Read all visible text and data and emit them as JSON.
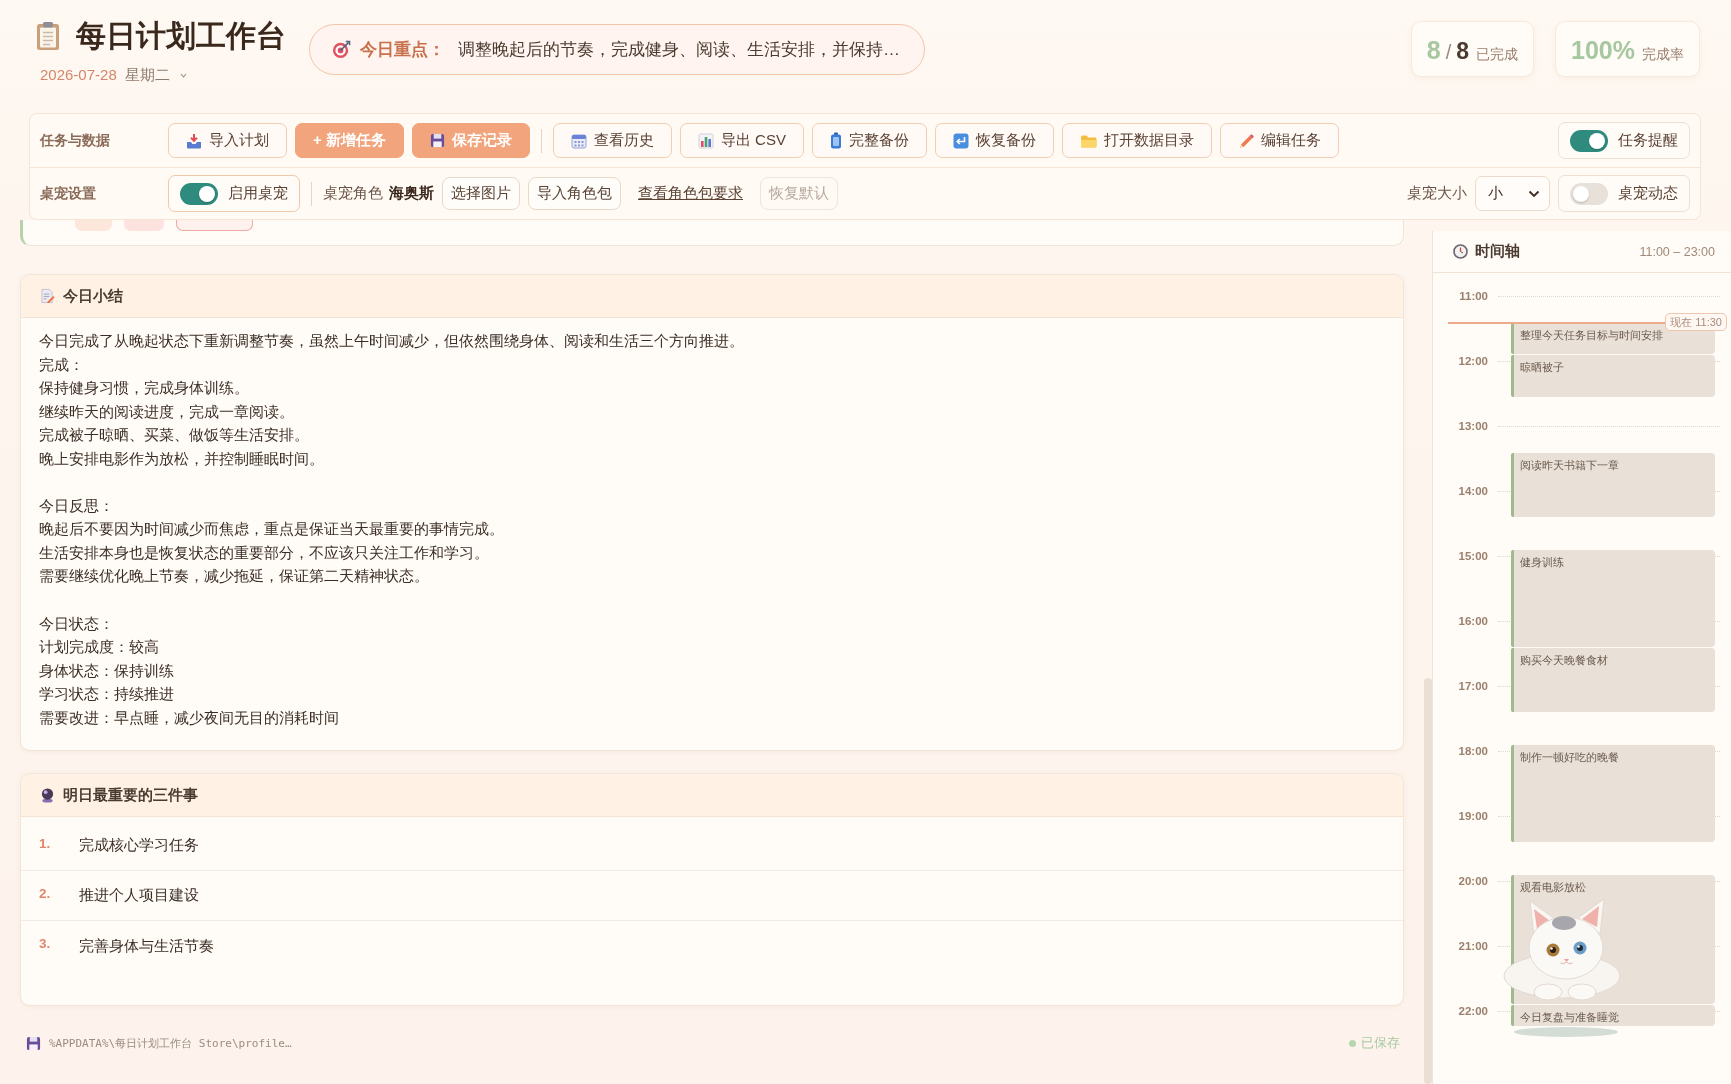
{
  "header": {
    "title": "每日计划工作台",
    "date": "2026-07-28",
    "weekday": "星期二",
    "focus": {
      "label": "今日重点：",
      "text": "调整晚起后的节奏，完成健身、阅读、生活安排，并保持…"
    },
    "stats": [
      {
        "kind": "count",
        "value": "8",
        "separator": "/",
        "total": "8",
        "label": "已完成"
      },
      {
        "kind": "rate",
        "value": "100%",
        "label": "完成率"
      }
    ]
  },
  "toolbar": {
    "rows": [
      {
        "label": "任务与数据",
        "items": [
          {
            "kind": "button",
            "label": "导入计划",
            "primary": false
          },
          {
            "kind": "button",
            "label": "+ 新增任务",
            "primary": true
          },
          {
            "kind": "button",
            "label": "保存记录",
            "primary": true
          },
          {
            "kind": "separator"
          },
          {
            "kind": "button",
            "label": "查看历史",
            "primary": false
          },
          {
            "kind": "button",
            "label": "导出 CSV",
            "primary": false
          },
          {
            "kind": "button",
            "label": "完整备份",
            "primary": false
          },
          {
            "kind": "button",
            "label": "恢复备份",
            "primary": false
          },
          {
            "kind": "button",
            "label": "打开数据目录",
            "primary": false
          },
          {
            "kind": "button",
            "label": "编辑任务",
            "primary": false
          }
        ],
        "right": [
          {
            "kind": "toggle",
            "label": "任务提醒",
            "on": true
          }
        ]
      },
      {
        "label": "桌宠设置",
        "items": [
          {
            "kind": "toggle",
            "label": "启用桌宠",
            "on": true
          },
          {
            "kind": "separator"
          },
          {
            "kind": "role",
            "label": "桌宠角色",
            "value": "海奥斯"
          },
          {
            "kind": "small_button",
            "label": "选择图片",
            "disabled": false
          },
          {
            "kind": "small_button",
            "label": "导入角色包",
            "disabled": false
          },
          {
            "kind": "link",
            "label": "查看角色包要求"
          },
          {
            "kind": "small_button",
            "label": "恢复默认",
            "disabled": true
          }
        ],
        "right": [
          {
            "kind": "select",
            "label": "桌宠大小",
            "value": "小"
          },
          {
            "kind": "toggle",
            "label": "桌宠动态",
            "on": false
          }
        ]
      }
    ]
  },
  "summary": {
    "title": "今日小结",
    "paragraphs": [
      [
        "今日完成了从晚起状态下重新调整节奏，虽然上午时间减少，但依然围绕身体、阅读和生活三个方向推进。",
        "完成：",
        "保持健身习惯，完成身体训练。",
        "继续昨天的阅读进度，完成一章阅读。",
        "完成被子晾晒、买菜、做饭等生活安排。",
        "晚上安排电影作为放松，并控制睡眠时间。"
      ],
      [
        "今日反思：",
        "晚起后不要因为时间减少而焦虑，重点是保证当天最重要的事情完成。",
        "生活安排本身也是恢复状态的重要部分，不应该只关注工作和学习。",
        "需要继续优化晚上节奏，减少拖延，保证第二天精神状态。"
      ],
      [
        "今日状态：",
        "计划完成度：较高",
        "身体状态：保持训练",
        "学习状态：持续推进",
        "需要改进：早点睡，减少夜间无目的消耗时间"
      ]
    ]
  },
  "tomorrow": {
    "title": "明日最重要的三件事",
    "items": [
      {
        "number": "1.",
        "text": "完成核心学习任务"
      },
      {
        "number": "2.",
        "text": "推进个人项目建设"
      },
      {
        "number": "3.",
        "text": "完善身体与生活节奏"
      }
    ]
  },
  "footer": {
    "path": "%APPDATA%\\每日计划工作台 Store\\profile…",
    "status": "已保存"
  },
  "timeline": {
    "title": "时间轴",
    "range": "11:00 – 23:00",
    "hours": [
      "11:00",
      "12:00",
      "13:00",
      "14:00",
      "15:00",
      "16:00",
      "17:00",
      "18:00",
      "19:00",
      "20:00",
      "21:00",
      "22:00"
    ],
    "now": "现在 11:30",
    "events": [
      {
        "title": "整理今天任务目标与时间安排"
      },
      {
        "title": "晾晒被子"
      },
      {
        "title": "阅读昨天书籍下一章"
      },
      {
        "title": "健身训练"
      },
      {
        "title": "购买今天晚餐食材"
      },
      {
        "title": "制作一顿好吃的晚餐"
      },
      {
        "title": "观看电影放松"
      },
      {
        "title": "今日复盘与准备睡觉"
      }
    ]
  }
}
